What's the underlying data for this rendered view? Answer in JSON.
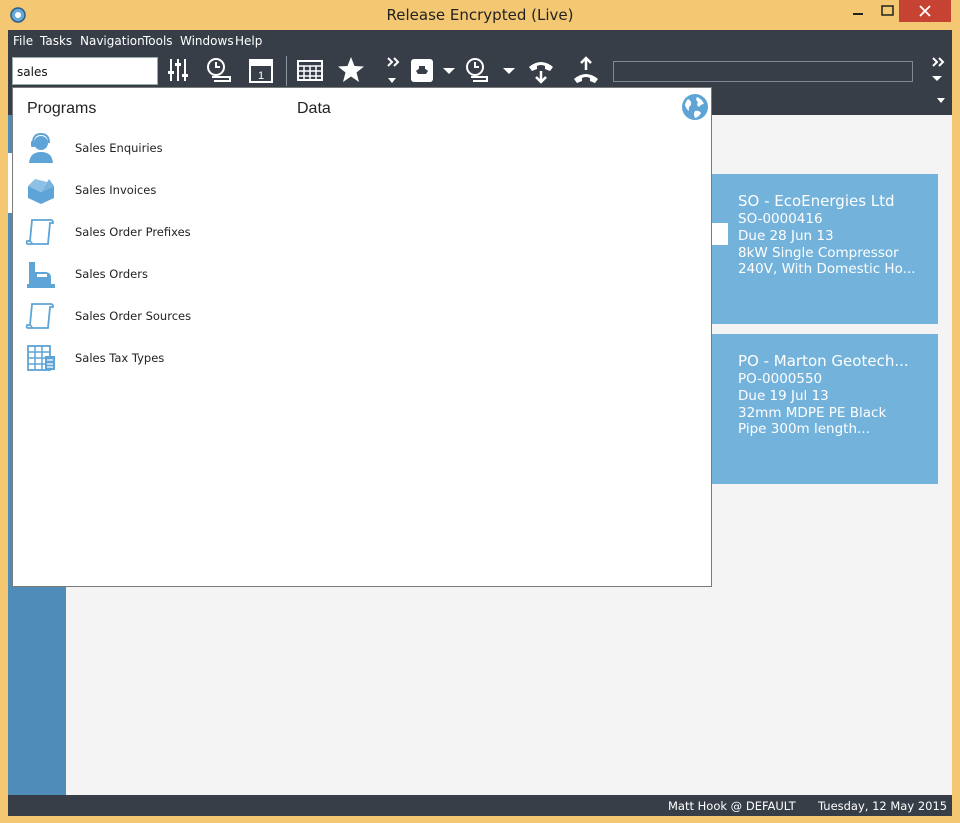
{
  "window": {
    "title": "Release Encrypted (Live)"
  },
  "menu": [
    "File",
    "Tasks",
    "Navigation",
    "Tools",
    "Windows",
    "Help"
  ],
  "search": {
    "value": "sales"
  },
  "dropdown": {
    "programs_header": "Programs",
    "data_header": "Data",
    "programs": [
      {
        "label": "Sales Enquiries",
        "icon": "headset-person-icon"
      },
      {
        "label": "Sales Invoices",
        "icon": "open-box-icon"
      },
      {
        "label": "Sales Order Prefixes",
        "icon": "scroll-icon"
      },
      {
        "label": "Sales Orders",
        "icon": "cash-register-icon"
      },
      {
        "label": "Sales Order Sources",
        "icon": "scroll-icon"
      },
      {
        "label": "Sales Tax Types",
        "icon": "grid-calculator-icon"
      }
    ]
  },
  "tiles": [
    {
      "title": "SO - EcoEnergies Ltd",
      "lines": [
        "SO-0000416",
        "Due 28 Jun 13",
        "8kW Single Compressor",
        "240V, With Domestic Ho..."
      ]
    },
    {
      "title": "PO - Marton Geotech...",
      "lines": [
        "PO-0000550",
        "Due 19 Jul 13",
        "32mm MDPE PE Black",
        "Pipe 300m length..."
      ]
    }
  ],
  "status": {
    "user": "Matt Hook @ DEFAULT",
    "date": "Tuesday, 12 May 2015"
  },
  "colors": {
    "title_bar": "#f4c872",
    "toolbar": "#373e48",
    "accent_blue": "#72b2db",
    "close_red": "#c64333"
  }
}
